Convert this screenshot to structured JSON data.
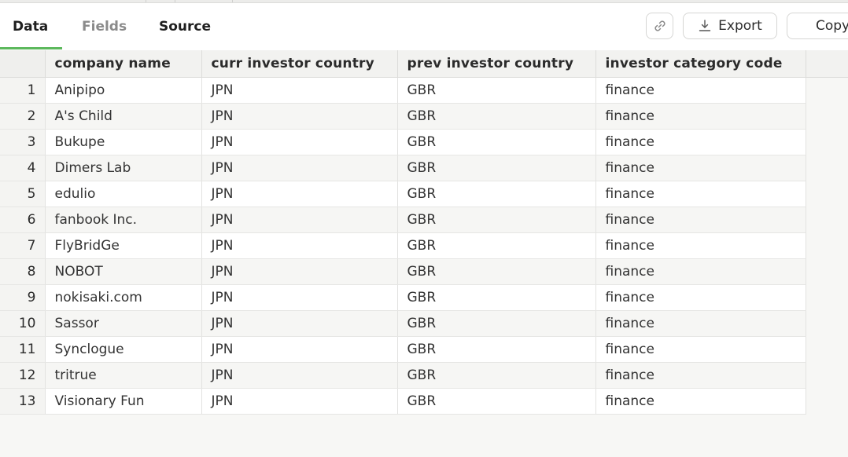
{
  "tabs": {
    "data": "Data",
    "fields": "Fields",
    "source": "Source"
  },
  "toolbar": {
    "link_icon": "link-icon",
    "export_label": "Export",
    "export_icon": "download-icon",
    "copy_label": "Copy"
  },
  "table": {
    "columns": [
      "company name",
      "curr investor country",
      "prev investor country",
      "investor category code"
    ],
    "rows": [
      {
        "num": "1",
        "company": "Anipipo",
        "curr": "JPN",
        "prev": "GBR",
        "category": "finance"
      },
      {
        "num": "2",
        "company": "A's Child",
        "curr": "JPN",
        "prev": "GBR",
        "category": "finance"
      },
      {
        "num": "3",
        "company": "Bukupe",
        "curr": "JPN",
        "prev": "GBR",
        "category": "finance"
      },
      {
        "num": "4",
        "company": "Dimers Lab",
        "curr": "JPN",
        "prev": "GBR",
        "category": "finance"
      },
      {
        "num": "5",
        "company": "edulio",
        "curr": "JPN",
        "prev": "GBR",
        "category": "finance"
      },
      {
        "num": "6",
        "company": "fanbook Inc.",
        "curr": "JPN",
        "prev": "GBR",
        "category": "finance"
      },
      {
        "num": "7",
        "company": "FlyBridGe",
        "curr": "JPN",
        "prev": "GBR",
        "category": "finance"
      },
      {
        "num": "8",
        "company": "NOBOT",
        "curr": "JPN",
        "prev": "GBR",
        "category": "finance"
      },
      {
        "num": "9",
        "company": "nokisaki.com",
        "curr": "JPN",
        "prev": "GBR",
        "category": "finance"
      },
      {
        "num": "10",
        "company": "Sassor",
        "curr": "JPN",
        "prev": "GBR",
        "category": "finance"
      },
      {
        "num": "11",
        "company": "Synclogue",
        "curr": "JPN",
        "prev": "GBR",
        "category": "finance"
      },
      {
        "num": "12",
        "company": "tritrue",
        "curr": "JPN",
        "prev": "GBR",
        "category": "finance"
      },
      {
        "num": "13",
        "company": "Visionary Fun",
        "curr": "JPN",
        "prev": "GBR",
        "category": "finance"
      }
    ]
  },
  "colors": {
    "active_tab_underline": "#5cb85c",
    "background": "#f7f7f5"
  }
}
